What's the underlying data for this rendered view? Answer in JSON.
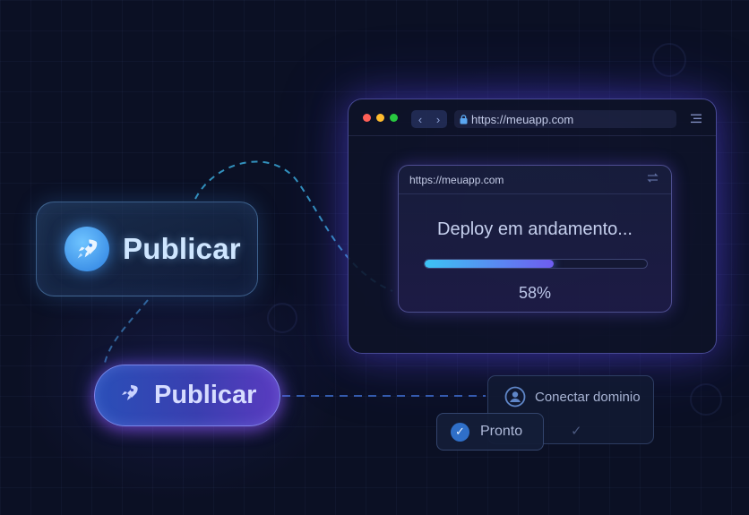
{
  "publish_card": {
    "label": "Publicar",
    "icon": "rocket-icon",
    "icon_color": "#3b8ef0"
  },
  "publish_pill": {
    "label": "Publicar",
    "icon": "rocket-icon"
  },
  "browser": {
    "url": "https://meuapp.com",
    "traffic_lights": [
      "#ff5f57",
      "#febc2e",
      "#28c840"
    ],
    "nav_back": "‹",
    "nav_forward": "›",
    "icons": [
      "lock-icon",
      "menu-icon"
    ]
  },
  "deploy_panel": {
    "url": "https://meuapp.com",
    "title": "Deploy em andamento...",
    "progress": 0.58,
    "progress_label": "58%",
    "icon": "swap-icon"
  },
  "domain_card": {
    "label": "Conectar dominio",
    "icon": "user-icon"
  },
  "ready_chip": {
    "label": "Pronto",
    "icon": "check-icon"
  },
  "colors": {
    "background": "#0b1024",
    "accent_blue": "#3cc4f4",
    "accent_purple": "#6f5cf0"
  }
}
